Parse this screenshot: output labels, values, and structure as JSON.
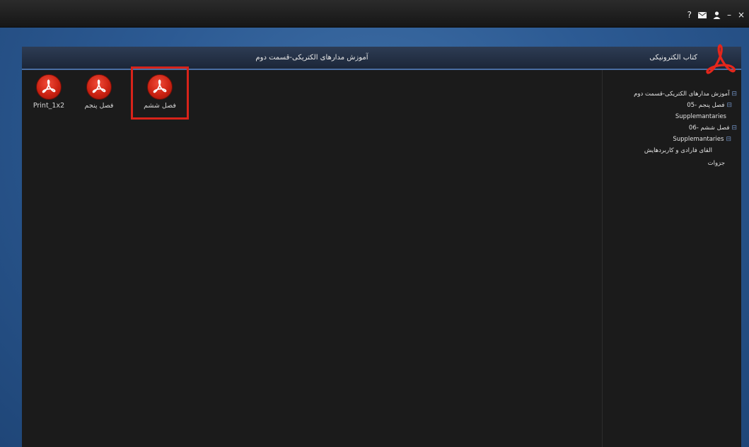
{
  "window_controls": [
    {
      "name": "help",
      "glyph": "?"
    },
    {
      "name": "mail",
      "glyph": ""
    },
    {
      "name": "user",
      "glyph": ""
    },
    {
      "name": "minimize",
      "glyph": "–"
    },
    {
      "name": "close",
      "glyph": "×"
    }
  ],
  "header": {
    "title": "آموزش مدارهای الکتریکی-قسمت دوم",
    "brand_title": "کتاب الکترونیکی"
  },
  "files": [
    {
      "label": "Print_1x2",
      "selected": false
    },
    {
      "label": "فصل پنجم",
      "selected": false
    },
    {
      "label": "فصل ششم",
      "selected": true
    }
  ],
  "tree": [
    {
      "label": "آموزش مدارهای الکتریکی-قسمت دوم",
      "toggle": "⊟"
    },
    {
      "label": "05- فصل پنجم",
      "toggle": "⊟"
    },
    {
      "label": "Supplemantaries",
      "toggle": ""
    },
    {
      "label": "06- فصل ششم",
      "toggle": "⊟"
    },
    {
      "label": "Supplemantaries",
      "toggle": "⊟"
    },
    {
      "label": "القای فارادی و کاربردهایش",
      "toggle": ""
    },
    {
      "label": "جزوات",
      "toggle": ""
    }
  ],
  "colors": {
    "accent_red": "#d8231a",
    "header_border": "#4a6ea3",
    "panel_bg": "#1b1b1b"
  }
}
